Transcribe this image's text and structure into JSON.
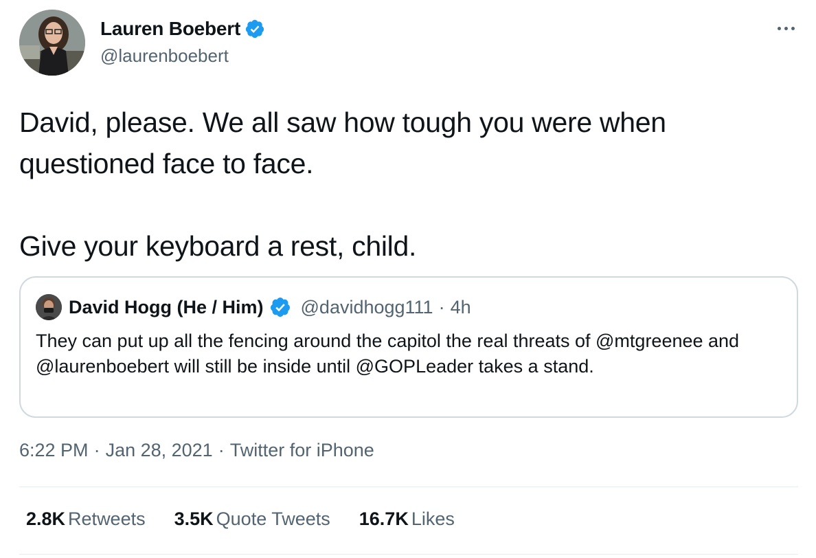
{
  "colors": {
    "text_primary": "#0f1419",
    "text_secondary": "#536471",
    "verified_blue": "#1d9bf0",
    "border": "#cfd9de"
  },
  "tweet": {
    "author": {
      "display_name": "Lauren Boebert",
      "handle": "@laurenboebert",
      "verified": true,
      "verified_icon": "verified-badge-icon"
    },
    "more_icon": "more-options-icon",
    "body_lines": [
      "David, please. We all saw how tough you were when questioned face to face.",
      "Give your keyboard a rest, child."
    ],
    "quoted_tweet": {
      "display_name": "David Hogg (He / Him)",
      "verified": true,
      "handle": "@davidhogg111",
      "separator": "·",
      "time": "4h",
      "text": "They can put up all the fencing around the capitol the real threats of @mtgreenee and @laurenboebert will still be inside until @GOPLeader takes a stand."
    },
    "meta": {
      "time": "6:22 PM",
      "separator": "·",
      "date": "Jan 28, 2021",
      "source": "Twitter for iPhone"
    },
    "stats": [
      {
        "count": "2.8K",
        "label": "Retweets"
      },
      {
        "count": "3.5K",
        "label": "Quote Tweets"
      },
      {
        "count": "16.7K",
        "label": "Likes"
      }
    ]
  }
}
